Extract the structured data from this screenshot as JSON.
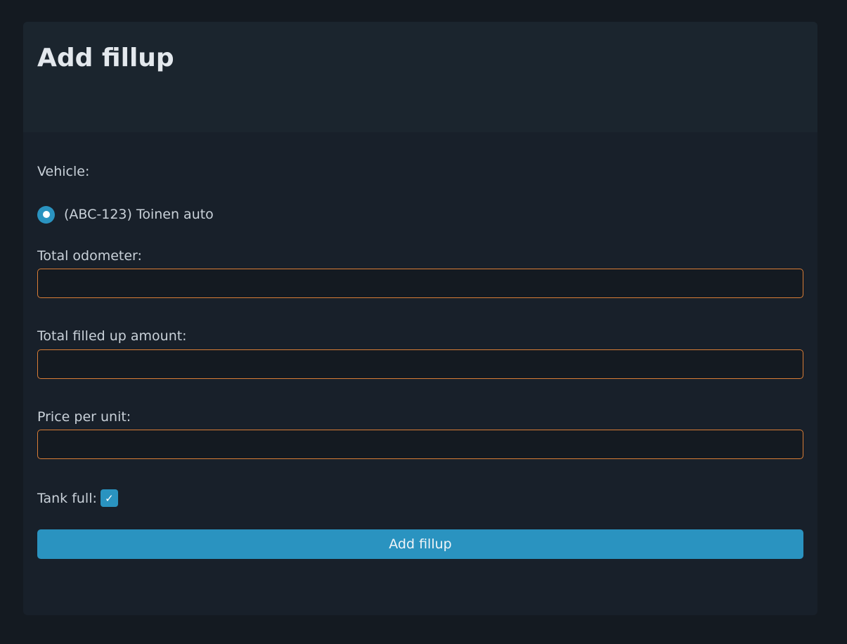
{
  "page": {
    "title": "Add fillup"
  },
  "form": {
    "vehicle_label": "Vehicle:",
    "vehicle_option": "(ABC-123) Toinen auto",
    "vehicle_selected": true,
    "odometer_label": "Total odometer:",
    "odometer_value": "",
    "amount_label": "Total filled up amount:",
    "amount_value": "",
    "price_label": "Price per unit:",
    "price_value": "",
    "tank_full_label": "Tank full:",
    "tank_full_checked": true,
    "submit_label": "Add fillup"
  },
  "icons": {
    "checkmark": "check-icon",
    "checkmark_glyph": "✓"
  },
  "colors": {
    "accent": "#2a93c0",
    "input_border": "#d97d36",
    "background": "#141a21",
    "card": "#18202a",
    "header": "#1b252e"
  }
}
